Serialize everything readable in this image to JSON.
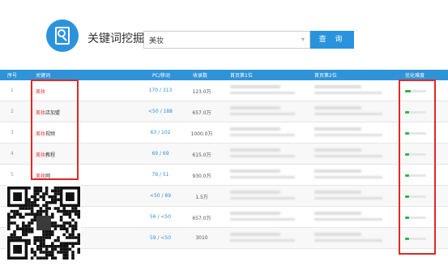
{
  "header": {
    "title": "关键词挖掘",
    "search_value": "美妆",
    "search_button": "查 询",
    "dropdown_arrow": "▾"
  },
  "table": {
    "columns": [
      "序号",
      "关键词",
      "PC/移动",
      "收录数",
      "首页第1位",
      "首页第2位",
      "优化难度"
    ],
    "rows": [
      {
        "idx": "1",
        "kw_hl": "美妆",
        "kw_rest": "",
        "pc": "170 / 313",
        "count": "123.0万",
        "difficulty": 0.25
      },
      {
        "idx": "2",
        "kw_hl": "美妆",
        "kw_rest": "店加盟",
        "pc": "<50 / 188",
        "count": "657.0万",
        "difficulty": 0.2
      },
      {
        "idx": "3",
        "kw_hl": "美妆",
        "kw_rest": "视频",
        "pc": "63 / 102",
        "count": "1000.0万",
        "difficulty": 0.2
      },
      {
        "idx": "4",
        "kw_hl": "美妆",
        "kw_rest": "教程",
        "pc": "69 / 69",
        "count": "615.0万",
        "difficulty": 0.2
      },
      {
        "idx": "5",
        "kw_hl": "美妆",
        "kw_rest": "网",
        "pc": "79 / 51",
        "count": "930.0万",
        "difficulty": 0.2
      },
      {
        "idx": "6",
        "kw_hl": "",
        "kw_rest": "",
        "pc": "<50 / 89",
        "count": "1.5万",
        "difficulty": 0.2
      },
      {
        "idx": "7",
        "kw_hl": "",
        "kw_rest": "",
        "pc": "56 / <50",
        "count": "657.0万",
        "difficulty": 0.2
      },
      {
        "idx": "8",
        "kw_hl": "",
        "kw_rest": "",
        "pc": "59 / <50",
        "count": "3010",
        "difficulty": 0.2
      }
    ]
  },
  "colors": {
    "accent": "#2f93d8",
    "highlight": "#e2322e",
    "annotation": "#e02727",
    "difficulty_fill": "#2eb54a"
  }
}
